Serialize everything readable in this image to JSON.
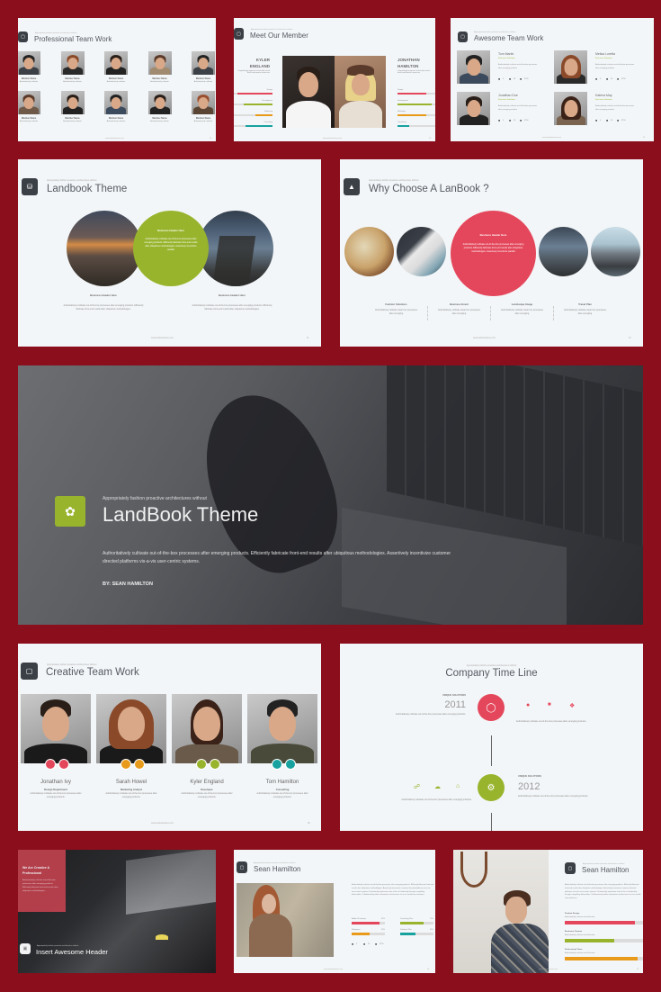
{
  "colors": {
    "background": "#8b0e1c",
    "red": "#e4475b",
    "green": "#98b42d",
    "orange": "#e89a1a",
    "teal": "#17a2a0",
    "dark": "#3b3f46"
  },
  "common": {
    "subtitle": "Appropriately fashion proactive architectures without",
    "footer": "www.websitename.com"
  },
  "slide1": {
    "title": "Professional Team Work",
    "page": "24",
    "members": [
      {
        "name": "Member Name",
        "role": "Authoritatively cultivate"
      },
      {
        "name": "Member Name",
        "role": "Authoritatively cultivate"
      },
      {
        "name": "Member Name",
        "role": "Authoritatively cultivate"
      },
      {
        "name": "Member Name",
        "role": "Authoritatively cultivate"
      },
      {
        "name": "Member Name",
        "role": "Authoritatively cultivate"
      },
      {
        "name": "Member Name",
        "role": "Authoritatively cultivate"
      },
      {
        "name": "Member Name",
        "role": "Authoritatively cultivate"
      },
      {
        "name": "Member Name",
        "role": "Authoritatively cultivate"
      },
      {
        "name": "Member Name",
        "role": "Authoritatively cultivate"
      },
      {
        "name": "Member Name",
        "role": "Authoritatively cultivate"
      }
    ]
  },
  "slide2": {
    "title": "Meet Our Member",
    "page": "19",
    "left": {
      "name1": "KYLER",
      "name2": "ENGLAND",
      "desc": "Compellingly engineer technically sound bricks-and-mortar resources",
      "skills": [
        {
          "label": "Design",
          "value": 90
        },
        {
          "label": "Development",
          "value": 75
        },
        {
          "label": "Marketing",
          "value": 45
        },
        {
          "label": "Consulting",
          "value": 70
        }
      ]
    },
    "right": {
      "name1": "JONATHAN",
      "name2": "HAMILTON",
      "desc": "Compellingly engineer technically sound bricks-and-mortar resources",
      "skills": [
        {
          "label": "Design",
          "value": 75
        },
        {
          "label": "Development",
          "value": 90
        },
        {
          "label": "Marketing",
          "value": 75
        },
        {
          "label": "Consulting",
          "value": 30
        }
      ]
    }
  },
  "slide3": {
    "title": "Awesome Team Work",
    "page": "21",
    "members": [
      {
        "name": "Tom Martin",
        "role": "Exclusive Solutions",
        "desc": "Authoritatively cultivate out-of-the-box processes after emerging products",
        "stats": [
          "4",
          "56",
          "8756"
        ]
      },
      {
        "name": "Melisa Loretta",
        "role": "Exclusive Solutions",
        "desc": "Authoritatively cultivate out-of-the-box processes after emerging products",
        "stats": [
          "4",
          "56",
          "8756"
        ]
      },
      {
        "name": "Jonathan Doe",
        "role": "Exclusive Solutions",
        "desc": "Authoritatively cultivate out-of-the-box processes after emerging products",
        "stats": [
          "4",
          "56",
          "8756"
        ]
      },
      {
        "name": "Katrina May",
        "role": "Exclusive Solutions",
        "desc": "Authoritatively cultivate out-of-the-box processes after emerging products",
        "stats": [
          "4",
          "56",
          "8756"
        ]
      }
    ]
  },
  "slide4": {
    "title": "Landbook Theme",
    "page": "11",
    "center_header": "Business Header Here",
    "center_text": "Authoritatively cultivate out-of-the-box processes after emerging products. Efficiently fabricate front-end results after ubiquitous methodologies. Assertively incentivize parallel",
    "cols": [
      {
        "header": "Business Header Here",
        "text": "Authoritatively cultivate out-of-the-box processes after emerging products. Efficiently fabricate front-end results after ubiquitous methodologies."
      },
      {
        "header": "Business Header Here",
        "text": "Authoritatively cultivate out-of-the-box processes after emerging products. Efficiently fabricate front-end results after ubiquitous methodologies."
      }
    ]
  },
  "slide5": {
    "title": "Why Choose A LanBook ?",
    "page": "10",
    "center_header": "Business Header Here",
    "center_text": "Authoritatively cultivate out-of-the-box processes after emerging products. Efficiently fabricate front-end results after ubiquitous methodologies. Assertively incentivize parallel",
    "cols": [
      {
        "header": "Fashion Solutions",
        "text": "Authoritatively cultivate clean box processes after emerging"
      },
      {
        "header": "Business Event",
        "text": "Authoritatively cultivate clean box processes after emerging"
      },
      {
        "header": "Landscape Image",
        "text": "Authoritatively cultivate clean box processes after emerging"
      },
      {
        "header": "Travel Plan",
        "text": "Authoritatively cultivate clean box processes after emerging"
      }
    ]
  },
  "slide6": {
    "subtitle": "Appropriately fashion proactive architectures without",
    "title": "LandBook Theme",
    "body": "Authoritatively cultivate out-of-the-box processes after emerging products. Efficiently fabricate front-end results after ubiquitous methodologies. Assertively incentivize customer directed platforms vis-a-vis user-centric systems.",
    "author": "BY: SEAN HAMILTON"
  },
  "slide7": {
    "title": "Creative Team Work",
    "page": "09",
    "members": [
      {
        "name": "Jonathan Ivy",
        "role": "Design Department",
        "desc": "Authoritatively cultivate out-of-the-box processes after emerging products."
      },
      {
        "name": "Sarah Howel",
        "role": "Marketing Analyst",
        "desc": "Authoritatively cultivate out-of-the-box processes after emerging products."
      },
      {
        "name": "Kyler England",
        "role": "Developer",
        "desc": "Authoritatively cultivate out-of-the-box processes after emerging products."
      },
      {
        "name": "Tom Hamilton",
        "role": "Consulting",
        "desc": "Authoritatively cultivate out-of-the-box processes after emerging products."
      }
    ]
  },
  "slide8": {
    "title": "Company Time Line",
    "events": [
      {
        "label": "UNIQUE SOLUTIONS",
        "year": "2011",
        "text": "Authoritatively cultivate out-of-the-box processes after emerging products.",
        "side_text": "Authoritatively cultivate out-of-the-box processes after emerging products."
      },
      {
        "label": "UNIQUE SOLUTIONS",
        "year": "2012",
        "text": "Authoritatively cultivate out-of-the-box processes after emerging products.",
        "side_text": "Authoritatively cultivate out-of-the-box processes after emerging products."
      }
    ]
  },
  "slide9": {
    "box_title": "We Are Creative & Professional",
    "box_text": "Authoritatively cultivate out-of-the-box processes after emerging products. Efficiently fabricate front-end results after ubiquitous methodologies.",
    "title": "Insert Awesome Header"
  },
  "slide10": {
    "title": "Sean Hamilton",
    "page": "26",
    "desc": "Authoritatively cultivate out-of-the-box processes after emerging products. Efficiently fabricate front-end results after ubiquitous methodologies. Assertively incentivize customer directed platforms vis-a-vis user-centric systems. Dramatically synthesize state of the art leadership through compelling deliverables. Collaboratively utilize substantive architectures vis-a-vis world-class initiatives.",
    "skills": [
      {
        "label": "Adobe Photoshop",
        "value": 85
      },
      {
        "label": "Consulting Plan",
        "value": 70
      },
      {
        "label": "Wordpress",
        "value": 55
      },
      {
        "label": "Solutions Plan",
        "value": 45
      }
    ],
    "stats": [
      "4",
      "56",
      "8756"
    ]
  },
  "slide11": {
    "title": "Sean Hamilton",
    "page": "28",
    "desc": "Authoritatively cultivate out-of-the-box processes after emerging products. Efficiently fabricate front-end results after ubiquitous methodologies. Assertively incentivize customer directed platforms vis-a-vis user-centric systems. Dramatically synthesize state of the art leadership through compelling deliverables. Collaboratively utilize substantive architectures vis-a-vis world-class initiatives.",
    "skills": [
      {
        "label": "Product Design",
        "sub": "Authoritatively cultivate out-of-the-box",
        "value": 90
      },
      {
        "label": "Exclusive Content",
        "sub": "Authoritatively cultivate out-of-the-box",
        "value": 63
      },
      {
        "label": "Professional Team",
        "sub": "Authoritatively cultivate out-of-the-box",
        "value": 93
      }
    ]
  }
}
